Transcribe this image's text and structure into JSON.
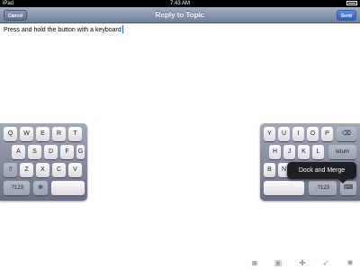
{
  "status_bar": {
    "carrier": "iPad",
    "time": "7:43 AM"
  },
  "nav": {
    "title": "Reply to Topic",
    "cancel_label": "Cancel",
    "send_label": "Send"
  },
  "editor": {
    "text": "Press and hold the button with a keyboard"
  },
  "keyboard_left": {
    "row1": [
      "Q",
      "W",
      "E",
      "R",
      "T"
    ],
    "row2": [
      "A",
      "S",
      "D",
      "F",
      "G"
    ],
    "shift_glyph": "⇧",
    "row3": [
      "Z",
      "X",
      "C",
      "V"
    ],
    "numbers_label": ".?123",
    "globe_glyph": "⊕"
  },
  "keyboard_right": {
    "row1": [
      "Y",
      "U",
      "I",
      "O",
      "P"
    ],
    "delete_glyph": "⌫",
    "row2": [
      "H",
      "J",
      "K",
      "L"
    ],
    "return_label": "return",
    "row3": [
      "B",
      "N"
    ],
    "numbers_label": ".?123",
    "dismiss_glyph": "⌨"
  },
  "popup": {
    "label": "Dock and Merge"
  },
  "toolbar": {
    "icons": [
      "camera-icon",
      "photo-icon",
      "puzzle-icon",
      "twitter-bird-icon",
      "gear-icon"
    ],
    "glyphs": [
      "◙",
      "▣",
      "✚",
      "➶",
      "✹"
    ]
  }
}
